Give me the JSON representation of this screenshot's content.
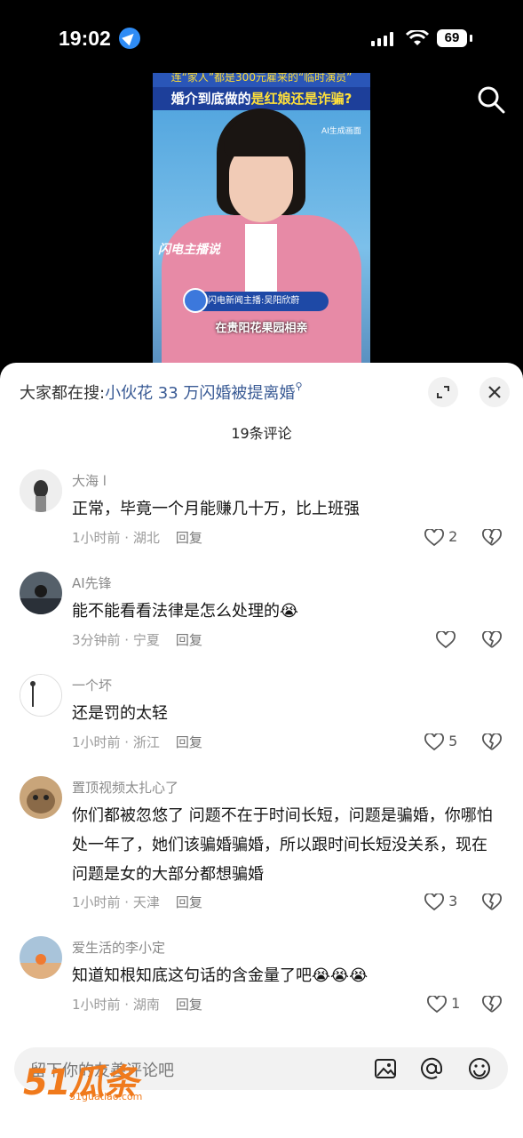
{
  "status_bar": {
    "time": "19:02",
    "battery": "69"
  },
  "video": {
    "title_line1": "连“家人”都是300元雇来的“临时演员”",
    "title_line2_a": "婚介到底做的",
    "title_line2_b": "是红娘还是诈骗?",
    "ai_tag": "AI生成画面",
    "brand": "闪电主播说",
    "anchor_label": "闪电新闻主播:吴阳欣蔚",
    "subtitle": "在贵阳花果园相亲"
  },
  "sheet": {
    "hot_search_prefix": "大家都在搜:",
    "hot_search_keyword": "小伙花 33 万闪婚被提离婚",
    "comment_count": "19条评论"
  },
  "comments": [
    {
      "name": "大海 l",
      "text": "正常，毕竟一个月能赚几十万，比上班强",
      "meta": "1小时前 · 湖北",
      "reply": "回复",
      "likes": "2"
    },
    {
      "name": "AI先锋",
      "text": "能不能看看法律是怎么处理的😭",
      "meta": "3分钟前 · 宁夏",
      "reply": "回复",
      "likes": ""
    },
    {
      "name": "一个坏",
      "text": "还是罚的太轻",
      "meta": "1小时前 · 浙江",
      "reply": "回复",
      "likes": "5"
    },
    {
      "name": "置顶视频太扎心了",
      "text": "你们都被忽悠了 问题不在于时间长短，问题是骗婚，你哪怕处一年了，她们该骗婚骗婚，所以跟时间长短没关系，现在问题是女的大部分都想骗婚",
      "meta": "1小时前 · 天津",
      "reply": "回复",
      "likes": "3"
    },
    {
      "name": "爱生活的李小定",
      "text": "知道知根知底这句话的含金量了吧😭😭😭",
      "meta": "1小时前 · 湖南",
      "reply": "回复",
      "likes": "1"
    }
  ],
  "input": {
    "placeholder": "留下你的友善评论吧"
  },
  "watermark": {
    "text": "51瓜条",
    "url": "51guatiao.com"
  }
}
